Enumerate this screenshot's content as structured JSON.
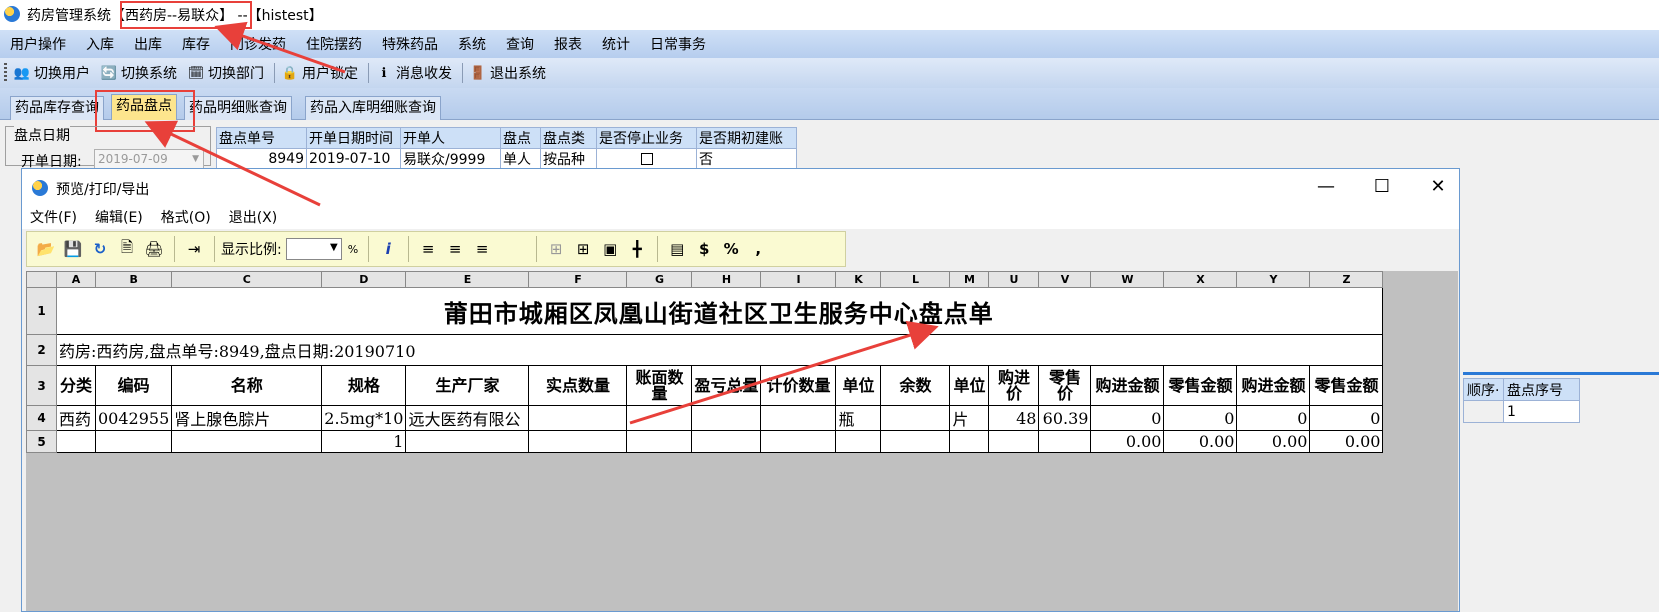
{
  "app": {
    "title_prefix": "药房管理系统",
    "title_dept": "【西药房--易联众】",
    "title_suffix": " --【histest】"
  },
  "menubar": [
    "用户操作",
    "入库",
    "出库",
    "库存",
    "门诊发药",
    "住院摆药",
    "特殊药品",
    "系统",
    "查询",
    "报表",
    "统计",
    "日常事务"
  ],
  "toolbar": [
    {
      "label": "切换用户",
      "icon": "users-icon"
    },
    {
      "label": "切换系统",
      "icon": "switch-system-icon"
    },
    {
      "label": "切换部门",
      "icon": "department-icon"
    },
    {
      "label": "用户锁定",
      "icon": "lock-user-icon"
    },
    {
      "label": "消息收发",
      "icon": "message-icon"
    },
    {
      "label": "退出系统",
      "icon": "exit-icon"
    }
  ],
  "tabs": [
    "药品库存查询",
    "药品盘点",
    "药品明细账查询",
    "药品入库明细账查询"
  ],
  "date_group": {
    "caption": "盘点日期",
    "label": "开单日期:",
    "value": "2019-07-09"
  },
  "top_grid": {
    "headers": [
      "盘点单号",
      "开单日期时间",
      "开单人",
      "盘点",
      "盘点类",
      "是否停止业务",
      "是否期初建账"
    ],
    "row": [
      "8949",
      "2019-07-10",
      "易联众/9999",
      "单人",
      "按品种",
      "",
      "否"
    ]
  },
  "right_grid": {
    "headers": [
      "顺序·",
      "盘点序号"
    ],
    "row": [
      "",
      "1"
    ]
  },
  "preview": {
    "title": "预览/打印/导出",
    "menu": [
      "文件(F)",
      "编辑(E)",
      "格式(O)",
      "退出(X)"
    ],
    "zoom_label": "显示比例:",
    "zoom_value": "",
    "zoom_unit": "%",
    "window_controls": {
      "minimize": "—",
      "maximize": "☐",
      "close": "✕"
    }
  },
  "sheet": {
    "columns": [
      "A",
      "B",
      "C",
      "D",
      "E",
      "F",
      "G",
      "H",
      "I",
      "K",
      "L",
      "M",
      "U",
      "V",
      "W",
      "X",
      "Y",
      "Z"
    ],
    "rows": [
      "1",
      "2",
      "3",
      "4",
      "5"
    ],
    "title": "莆田市城厢区凤凰山街道社区卫生服务中心盘点单",
    "info": "药房:西药房,盘点单号:8949,盘点日期:20190710",
    "headers": [
      "分类",
      "编码",
      "名称",
      "规格",
      "生产厂家",
      "实点数量",
      "账面数量",
      "盈亏总量",
      "计价数量",
      "单位",
      "余数",
      "单位",
      "购进价",
      "零售价",
      "购进金额",
      "零售金额",
      "购进金额",
      "零售金额"
    ],
    "row4": [
      "西药",
      "0042955",
      "肾上腺色腙片",
      "2.5mg*10",
      "远大医药有限公",
      "",
      "",
      "",
      "",
      "瓶",
      "",
      "片",
      "48",
      "60.39",
      "0",
      "0",
      "0",
      "0"
    ],
    "row5": [
      "",
      "",
      "",
      "1",
      "",
      "",
      "",
      "",
      "",
      "",
      "",
      "",
      "",
      "",
      "0.00",
      "0.00",
      "0.00",
      "0.00"
    ]
  }
}
